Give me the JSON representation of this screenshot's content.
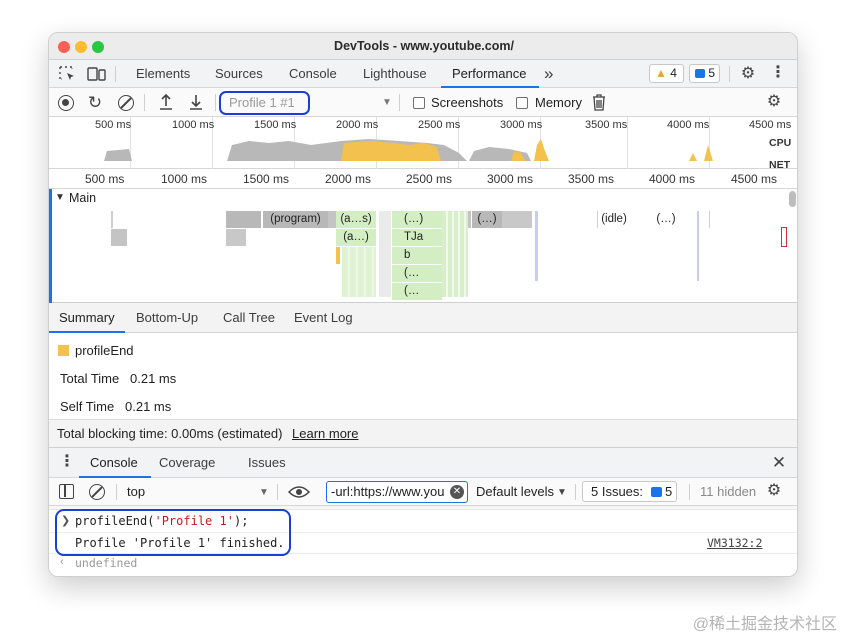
{
  "window": {
    "title": "DevTools - www.youtube.com/"
  },
  "main_tabs": [
    "Elements",
    "Sources",
    "Console",
    "Lighthouse",
    "Performance"
  ],
  "more_tabs_glyph": "»",
  "warnings_count": "4",
  "messages_count": "5",
  "perf_toolbar": {
    "profile_select": "Profile 1 #1",
    "screenshots_label": "Screenshots",
    "memory_label": "Memory"
  },
  "overview": {
    "ticks": [
      "500 ms",
      "1000 ms",
      "1500 ms",
      "2000 ms",
      "2500 ms",
      "3000 ms",
      "3500 ms",
      "4000 ms",
      "4500 ms"
    ],
    "cpu_label": "CPU",
    "net_label": "NET"
  },
  "ruler_ticks": [
    "500 ms",
    "1000 ms",
    "1500 ms",
    "2000 ms",
    "2500 ms",
    "3000 ms",
    "3500 ms",
    "4000 ms",
    "4500 ms"
  ],
  "main_track": {
    "title": "Main",
    "labels": [
      "(program)",
      "(a…s)",
      "(…)",
      "(…)",
      "(idle)",
      "(…)",
      "(a…)",
      "TJa",
      "b",
      "(…",
      "(…"
    ]
  },
  "bottom_tabs": [
    "Summary",
    "Bottom-Up",
    "Call Tree",
    "Event Log"
  ],
  "summary": {
    "event_name": "profileEnd",
    "total_time_label": "Total Time",
    "total_time_value": "0.21 ms",
    "self_time_label": "Self Time",
    "self_time_value": "0.21 ms"
  },
  "blocking": {
    "text": "Total blocking time: 0.00ms (estimated)",
    "link": "Learn more"
  },
  "drawer_tabs": [
    "Console",
    "Coverage",
    "Issues"
  ],
  "console_toolbar": {
    "context": "top",
    "filter_value": "-url:https://www.you",
    "levels": "Default levels",
    "issues_label": "5 Issues:",
    "issues_count": "5",
    "hidden": "11 hidden"
  },
  "console_output": {
    "input": "profileEnd('Profile 1');",
    "input_fn": "profileEnd(",
    "input_arg": "'Profile 1'",
    "input_end": ");",
    "message": "Profile 'Profile 1' finished.",
    "source_link": "VM3132:2",
    "result": "undefined"
  },
  "colors": {
    "accent": "#1a73e8",
    "highlight_border": "#1a3fd6",
    "scripting_yellow": "#f2c14e",
    "system_gray": "#b8b8b8",
    "js_green": "#d4eec4",
    "warning_orange": "#e8a33d"
  },
  "watermark": "@稀土掘金技术社区"
}
